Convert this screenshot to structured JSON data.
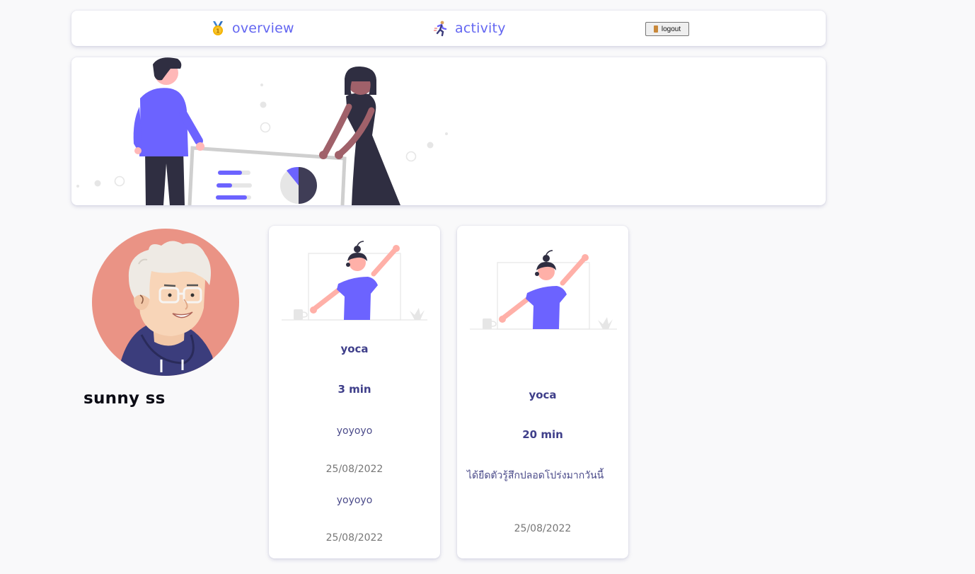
{
  "nav": {
    "overview_label": "overview",
    "activity_label": "activity",
    "logout_label": "logout",
    "overview_icon": "medal-icon",
    "activity_icon": "running-person-icon"
  },
  "profile": {
    "name": "sunny ss"
  },
  "activities": [
    {
      "title": "yoca",
      "duration": "3 min",
      "entries": [
        {
          "note": "yoyoyo",
          "date": "25/08/2022"
        },
        {
          "note": "yoyoyo",
          "date": "25/08/2022"
        }
      ]
    },
    {
      "title": "yoca",
      "duration": "20 min",
      "entries": [
        {
          "note": "ได้ยืดตัวรู้สึกปลอดโปร่งมากวันนี้",
          "date": "25/08/2022"
        }
      ]
    }
  ],
  "colors": {
    "accent": "#6366f1",
    "figure_purple": "#6c63ff",
    "dark": "#2f2e41",
    "avatar_bg": "#ea9385"
  }
}
